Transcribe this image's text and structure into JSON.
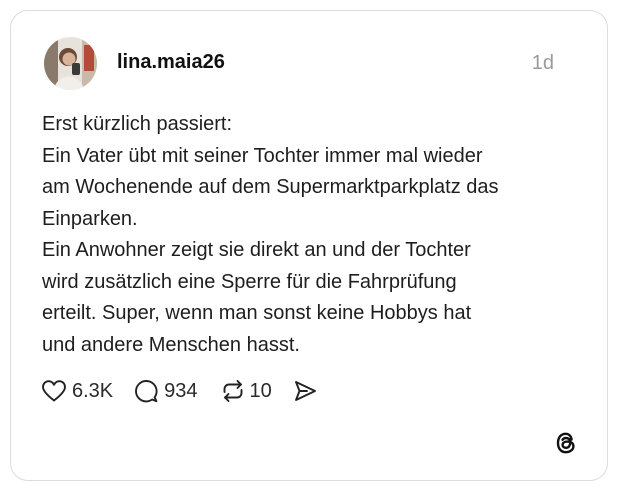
{
  "post": {
    "username": "lina.maia26",
    "time": "1d",
    "lines": [
      "Erst kürzlich passiert:",
      "Ein Vater übt mit seiner Tochter immer mal wieder",
      "am Wochenende auf dem Supermarktparkplatz das",
      "Einparken.",
      "Ein Anwohner zeigt sie direkt an und der Tochter",
      "wird zusätzlich eine Sperre für die Fahrprüfung",
      "erteilt. Super, wenn man sonst keine Hobbys hat",
      "und andere Menschen hasst."
    ]
  },
  "actions": {
    "likes": "6.3K",
    "comments": "934",
    "reposts": "10"
  },
  "icons": {
    "like": "heart-icon",
    "comment": "speech-bubble-icon",
    "repost": "repost-icon",
    "share": "send-icon",
    "brand": "threads-logo-icon"
  }
}
